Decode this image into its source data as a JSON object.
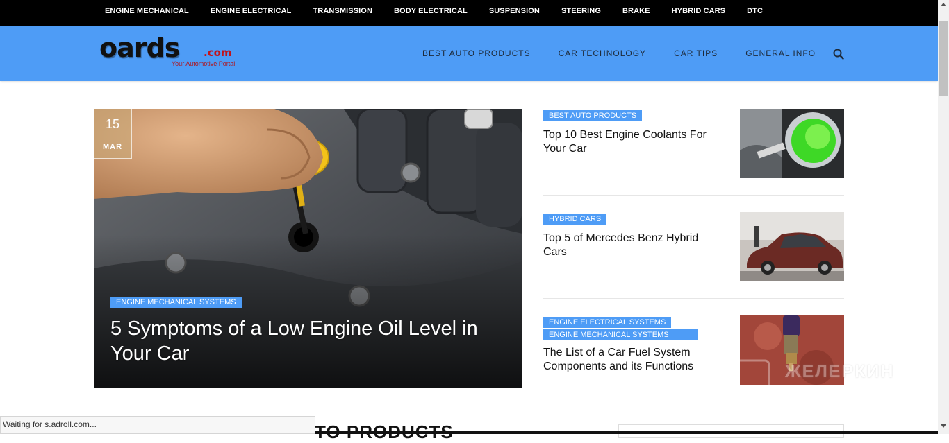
{
  "top_nav": [
    "ENGINE MECHANICAL",
    "ENGINE ELECTRICAL",
    "TRANSMISSION",
    "BODY ELECTRICAL",
    "SUSPENSION",
    "STEERING",
    "BRAKE",
    "HYBRID CARS",
    "DTC"
  ],
  "logo": {
    "word": "oards",
    "suffix": ".com",
    "tagline": "Your Automotive Portal"
  },
  "main_nav": [
    "BEST AUTO PRODUCTS",
    "CAR TECHNOLOGY",
    "CAR TIPS",
    "GENERAL INFO"
  ],
  "hero": {
    "day": "15",
    "month": "MAR",
    "category": "ENGINE MECHANICAL SYSTEMS",
    "title": "5 Symptoms of a Low Engine Oil Level in Your Car"
  },
  "posts": [
    {
      "categories": [
        "BEST AUTO PRODUCTS"
      ],
      "title": "Top 10 Best Engine Coolants For Your Car",
      "thumb": "coolant-reservoir"
    },
    {
      "categories": [
        "HYBRID CARS"
      ],
      "title": "Top 5 of Mercedes Benz Hybrid Cars",
      "thumb": "mercedes-hybrid-car"
    },
    {
      "categories": [
        "ENGINE ELECTRICAL SYSTEMS",
        "ENGINE MECHANICAL SYSTEMS"
      ],
      "title": "The List of a Car Fuel System Components and its Functions",
      "thumb": "fuel-injector"
    }
  ],
  "section_title": "TO PRODUCTS",
  "status_text": "Waiting for s.adroll.com...",
  "watermark": "ЖЕЛЕРКИН",
  "colors": {
    "accent": "#4e9cf6",
    "topbar": "#000000",
    "logo_red": "#c0141c"
  }
}
